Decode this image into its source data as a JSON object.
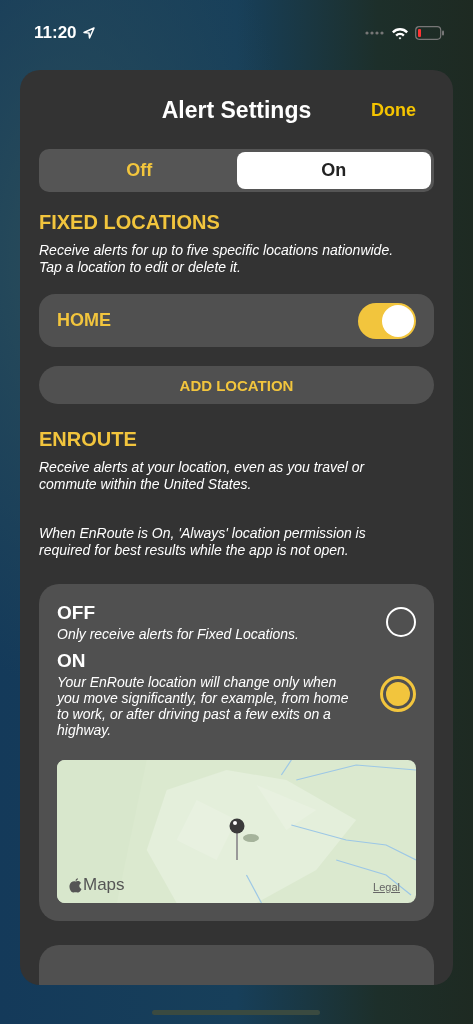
{
  "status_bar": {
    "time": "11:20"
  },
  "sheet": {
    "title": "Alert Settings",
    "done": "Done"
  },
  "alerts_toggle": [
    {
      "label": "Off",
      "selected": false
    },
    {
      "label": "On",
      "selected": true
    }
  ],
  "fixed_locations": {
    "heading": "FIXED LOCATIONS",
    "description": "Receive alerts for up to five specific locations nationwide. Tap a location to edit or delete it.",
    "locations": [
      {
        "name": "HOME",
        "on": true
      }
    ],
    "add_button": "ADD LOCATION"
  },
  "enroute": {
    "heading": "ENROUTE",
    "description": "Receive alerts at your location, even as you travel or commute within the United States.",
    "note": "When EnRoute is On, 'Always' location permission is required for best results while the app is not open.",
    "options": [
      {
        "label": "OFF",
        "description": "Only receive alerts for Fixed Locations.",
        "selected": false
      },
      {
        "label": "ON",
        "description": "Your EnRoute location will change only when you move significantly, for example, from home to work, or after driving past a few exits on a highway.",
        "selected": true
      }
    ],
    "map": {
      "kind": "picture",
      "attribution": "Maps",
      "legal": "Legal"
    }
  }
}
